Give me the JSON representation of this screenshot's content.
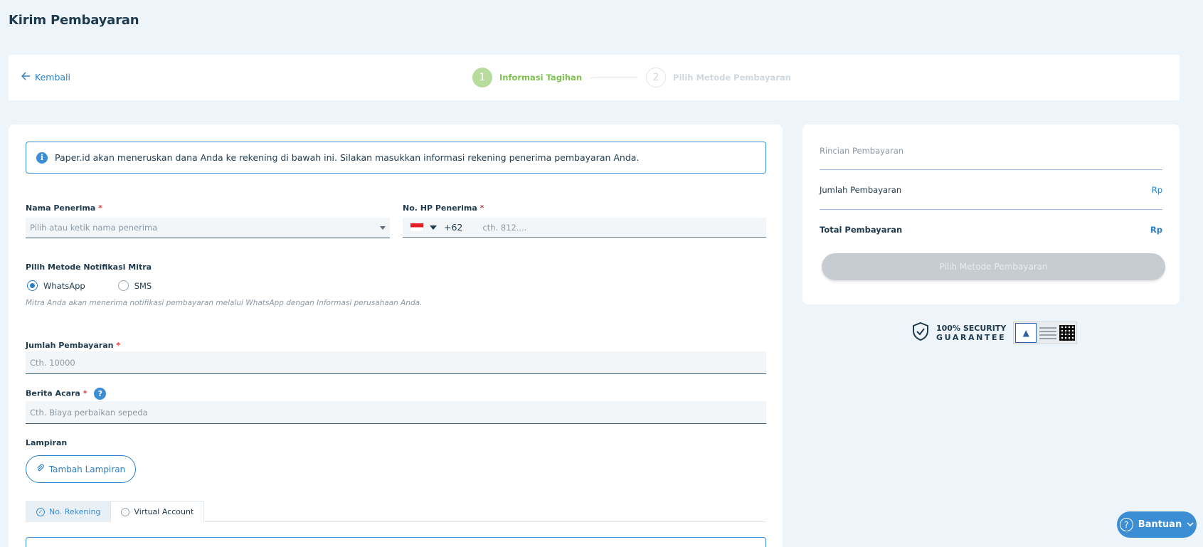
{
  "page": {
    "title": "Kirim Pembayaran"
  },
  "topbar": {
    "back_label": "Kembali",
    "steps": [
      {
        "number": "1",
        "label": "Informasi Tagihan",
        "state": "active"
      },
      {
        "number": "2",
        "label": "Pilih Metode Pembayaran",
        "state": "inactive"
      }
    ]
  },
  "form": {
    "info_text": "Paper.id akan meneruskan dana Anda ke rekening di bawah ini. Silakan masukkan informasi rekening penerima pembayaran Anda.",
    "recipient_name": {
      "label": "Nama Penerima",
      "required_mark": "*",
      "placeholder": "Pilih atau ketik nama penerima"
    },
    "recipient_phone": {
      "label": "No. HP Penerima",
      "required_mark": "*",
      "country_code": "+62",
      "placeholder": "cth. 812...."
    },
    "notification": {
      "label": "Pilih Metode Notifikasi Mitra",
      "options": [
        {
          "label": "WhatsApp",
          "selected": true
        },
        {
          "label": "SMS",
          "selected": false
        }
      ],
      "hint": "Mitra Anda akan menerima notifikasi pembayaran melalui WhatsApp dengan Informasi perusahaan Anda."
    },
    "amount": {
      "label": "Jumlah Pembayaran",
      "required_mark": "*",
      "placeholder": "Cth. 10000"
    },
    "memo": {
      "label": "Berita Acara",
      "required_mark": "*",
      "help": "?",
      "placeholder": "Cth. Biaya perbaikan sepeda"
    },
    "attachment": {
      "label": "Lampiran",
      "button_label": "Tambah Lampiran"
    },
    "account_tabs": [
      {
        "label": "No. Rekening",
        "active": true
      },
      {
        "label": "Virtual Account",
        "active": false
      }
    ]
  },
  "summary": {
    "title": "Rincian Pembayaran",
    "rows": [
      {
        "label": "Jumlah Pembayaran",
        "value": "Rp"
      },
      {
        "label": "Total Pembayaran",
        "value": "Rp"
      }
    ],
    "button_label": "Pilih Metode Pembayaran"
  },
  "security": {
    "line1": "100% SECURITY",
    "line2": "GUARANTEE"
  },
  "help_button": {
    "label": "Bantuan",
    "icon": "?"
  },
  "colors": {
    "primary": "#3b8ed3",
    "step_active": "#7ec04f",
    "required": "#e03b3b",
    "background": "#eef5fa"
  }
}
